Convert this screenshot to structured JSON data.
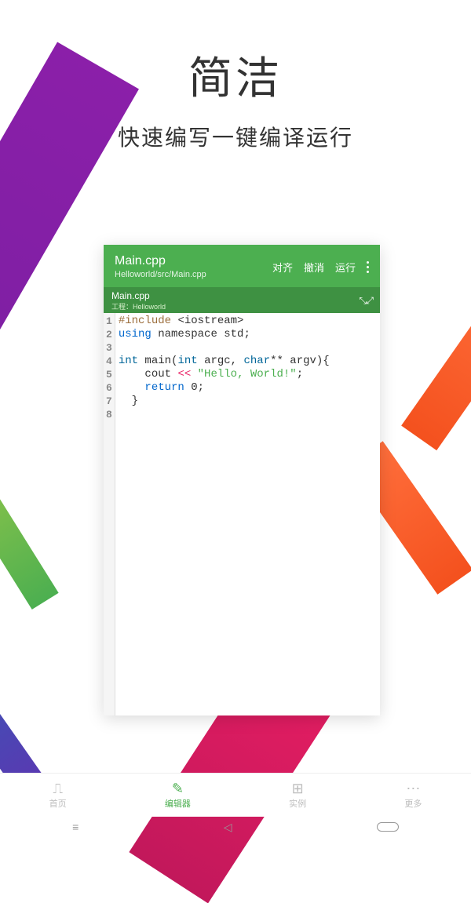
{
  "hero": {
    "title": "简洁",
    "subtitle": "快速编写一键编译运行"
  },
  "editor": {
    "title": "Main.cpp",
    "path": "Helloworld/src/Main.cpp",
    "tab": "Main.cpp",
    "project": "工程：Helloworld",
    "actions": {
      "align": "对齐",
      "undo": "撤消",
      "run": "运行"
    },
    "lines": [
      "1",
      "2",
      "3",
      "4",
      "5",
      "6",
      "7",
      "8"
    ],
    "code": {
      "l1a": "#include ",
      "l1b": "<iostream>",
      "l2a": "using",
      "l2b": " namespace std;",
      "l4a": "int",
      "l4b": " main(",
      "l4c": "int",
      "l4d": " argc, ",
      "l4e": "char",
      "l4f": "** argv){",
      "l5a": "    cout ",
      "l5b": "<<",
      "l5c": " ",
      "l5d": "\"Hello, World!\"",
      "l5e": ";",
      "l6a": "    ",
      "l6b": "return",
      "l6c": " 0;",
      "l7": "  }"
    }
  },
  "nav": {
    "home": "首页",
    "editor": "编辑器",
    "examples": "实例",
    "more": "更多"
  }
}
